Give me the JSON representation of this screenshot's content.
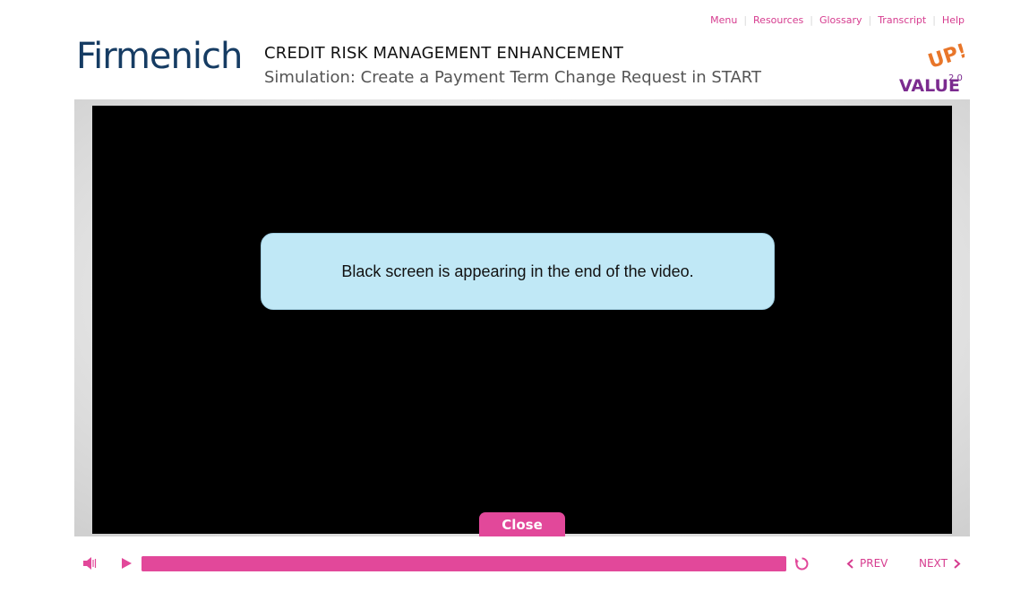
{
  "topnav": {
    "items": [
      "Menu",
      "Resources",
      "Glossary",
      "Transcript",
      "Help"
    ]
  },
  "header": {
    "logo_text": "Firmenich",
    "title": "CREDIT RISK MANAGEMENT ENHANCEMENT",
    "subtitle": "Simulation: Create a Payment Term Change Request in START",
    "brand_mark": {
      "word": "VALUE",
      "exclaim": "UP!",
      "version": "2.0"
    }
  },
  "video": {
    "notice_text": "Black screen is appearing in the end of the video.",
    "close_label": "Close"
  },
  "controls": {
    "progress_fraction": 1.0,
    "prev_label": "PREV",
    "next_label": "NEXT",
    "icons": [
      "volume-icon",
      "play-icon",
      "replay-icon",
      "chevron-left-icon",
      "chevron-right-icon"
    ]
  },
  "colors": {
    "accent": "#e2489a",
    "link": "#d63c8f",
    "logo": "#163c63",
    "notice_bg": "#c0e8f6",
    "brand_orange": "#e8762a",
    "brand_purple": "#7b2b8f"
  }
}
